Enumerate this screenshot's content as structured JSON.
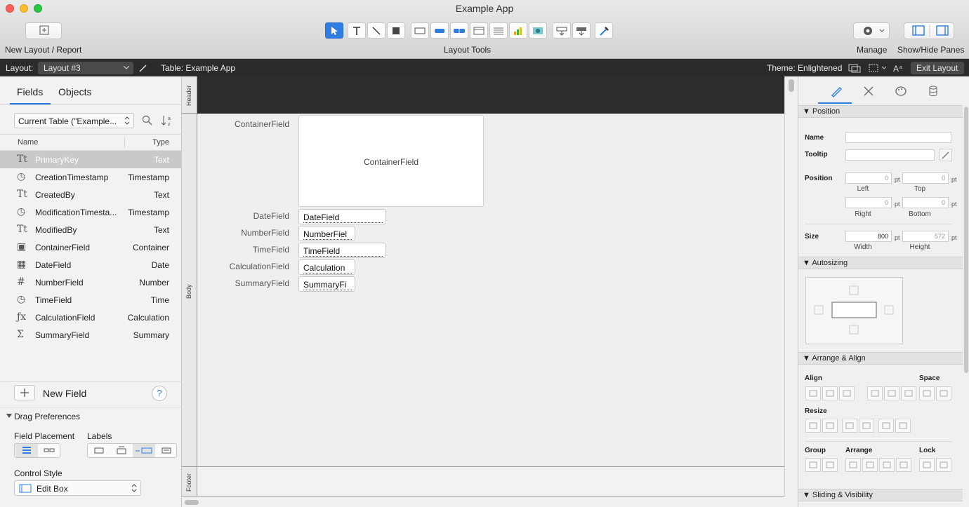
{
  "window": {
    "title": "Example App"
  },
  "toolbar": {
    "new_layout_label": "New Layout / Report",
    "layout_tools_label": "Layout Tools",
    "manage_label": "Manage",
    "show_hide_label": "Show/Hide Panes"
  },
  "layout_bar": {
    "layout_prefix": "Layout:",
    "layout_name": "Layout #3",
    "table_label": "Table: Example App",
    "theme_label": "Theme: Enlightened",
    "exit_label": "Exit Layout"
  },
  "left_pane": {
    "tabs": [
      "Fields",
      "Objects"
    ],
    "table_select": "Current Table (\"Example...",
    "col_name": "Name",
    "col_type": "Type",
    "fields": [
      {
        "name": "PrimaryKey",
        "type": "Text",
        "icon": "text-icon"
      },
      {
        "name": "CreationTimestamp",
        "type": "Timestamp",
        "icon": "timestamp-icon"
      },
      {
        "name": "CreatedBy",
        "type": "Text",
        "icon": "text-icon"
      },
      {
        "name": "ModificationTimesta...",
        "type": "Timestamp",
        "icon": "timestamp-icon"
      },
      {
        "name": "ModifiedBy",
        "type": "Text",
        "icon": "text-icon"
      },
      {
        "name": "ContainerField",
        "type": "Container",
        "icon": "container-icon"
      },
      {
        "name": "DateField",
        "type": "Date",
        "icon": "date-icon"
      },
      {
        "name": "NumberField",
        "type": "Number",
        "icon": "number-icon"
      },
      {
        "name": "TimeField",
        "type": "Time",
        "icon": "time-icon"
      },
      {
        "name": "CalculationField",
        "type": "Calculation",
        "icon": "calculation-icon"
      },
      {
        "name": "SummaryField",
        "type": "Summary",
        "icon": "summary-icon"
      }
    ],
    "new_field_label": "New Field",
    "help_glyph": "?",
    "drag_prefs_label": "Drag Preferences",
    "field_placement_label": "Field Placement",
    "labels_label": "Labels",
    "control_style_label": "Control Style",
    "control_style_value": "Edit Box"
  },
  "canvas": {
    "parts": {
      "header": "Header",
      "body": "Body",
      "footer": "Footer"
    },
    "container_label": "ContainerField",
    "container_inner": "ContainerField",
    "fields": [
      {
        "label": "DateField",
        "value": "DateField"
      },
      {
        "label": "NumberField",
        "value": "NumberFiel"
      },
      {
        "label": "TimeField",
        "value": "TimeField"
      },
      {
        "label": "CalculationField",
        "value": "Calculation"
      },
      {
        "label": "SummaryField",
        "value": "SummaryFi"
      }
    ]
  },
  "inspector": {
    "position_section": "Position",
    "name_label": "Name",
    "tooltip_label": "Tooltip",
    "position_label": "Position",
    "left_value": "0",
    "top_value": "0",
    "right_value": "0",
    "bottom_value": "0",
    "unit": "pt",
    "left_label": "Left",
    "top_label": "Top",
    "right_label": "Right",
    "bottom_label": "Bottom",
    "size_label": "Size",
    "width_value": "800",
    "height_value": "572",
    "width_label": "Width",
    "height_label": "Height",
    "autosizing_section": "Autosizing",
    "arrange_section": "Arrange & Align",
    "align_label": "Align",
    "space_label": "Space",
    "resize_label": "Resize",
    "group_label": "Group",
    "arrange_label": "Arrange",
    "lock_label": "Lock",
    "sliding_section": "Sliding & Visibility"
  },
  "colors": {
    "accent": "#2f7de1",
    "dark_bar": "#2b2b2b",
    "header_part": "#2d2d2d"
  }
}
